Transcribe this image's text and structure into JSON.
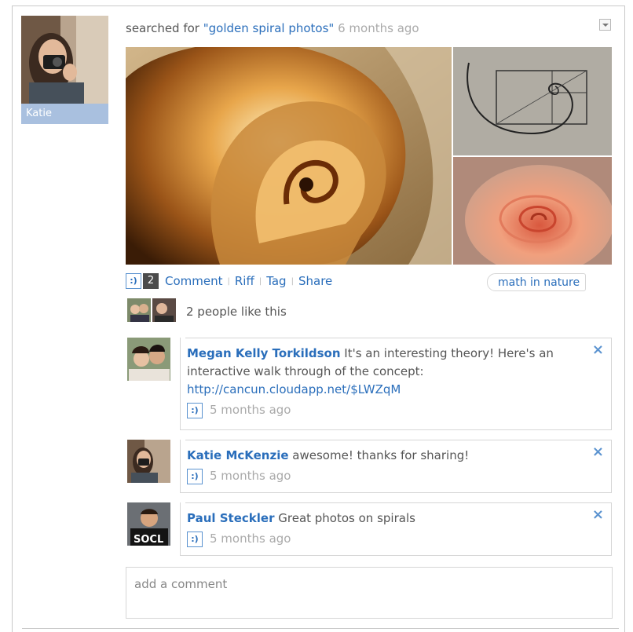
{
  "post": {
    "author": "Katie",
    "action_text": "searched for ",
    "query": "\"golden spiral photos\"",
    "time": "6 months ago"
  },
  "actions": {
    "smiley": ":)",
    "like_count": "2",
    "comment_label": "Comment",
    "riff_label": "Riff",
    "tag_label": "Tag",
    "share_label": "Share",
    "separator": "|"
  },
  "tag": "math in nature",
  "likes_text": "2 people like this",
  "comments": [
    {
      "author": "Megan Kelly Torkildson",
      "text": " It's an interesting theory! Here's an interactive walk through of the concept:",
      "link": "http://cancun.cloudapp.net/$LWZqM",
      "time": "5 months ago"
    },
    {
      "author": "Katie McKenzie",
      "text": " awesome! thanks for sharing!",
      "time": "5 months ago"
    },
    {
      "author": "Paul Steckler",
      "text": " Great photos on spirals",
      "time": "5 months ago"
    }
  ],
  "close_glyph": "×",
  "add_comment": {
    "placeholder": "add a comment"
  },
  "avatar_badge_text": "SOCL",
  "colors": {
    "link": "#2a6ebb",
    "name_bar": "#a9c0df",
    "border": "#d6d6d6",
    "muted": "#aaaaaa"
  },
  "icons": [
    "chevron-down-icon",
    "smiley-icon",
    "close-icon"
  ]
}
